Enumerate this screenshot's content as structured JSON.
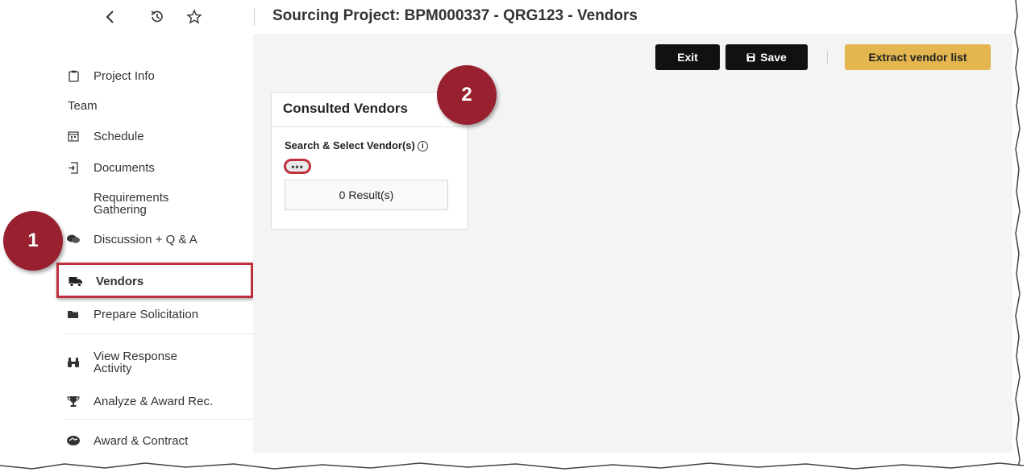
{
  "header": {
    "title": "Sourcing Project: BPM000337 - QRG123 - Vendors",
    "icons": [
      "back-icon",
      "history-icon",
      "star-icon"
    ]
  },
  "sidebar": {
    "items": [
      {
        "label": "Project Info",
        "icon": "clipboard-icon"
      },
      {
        "label": "Team"
      },
      {
        "label": "Schedule",
        "icon": "calendar-icon"
      },
      {
        "label": "Documents",
        "icon": "document-import-icon"
      },
      {
        "label": "Requirements Gathering"
      },
      {
        "label": "Discussion + Q & A",
        "icon": "comments-icon"
      },
      {
        "label": "Vendors",
        "icon": "truck-icon",
        "active": true
      },
      {
        "label": "Prepare Solicitation",
        "icon": "folder-icon"
      },
      {
        "label": "View Response Activity",
        "icon": "binoculars-icon"
      },
      {
        "label": "Analyze & Award Rec.",
        "icon": "trophy-icon"
      },
      {
        "label": "Award & Contract",
        "icon": "handshake-icon"
      }
    ]
  },
  "toolbar": {
    "exit_label": "Exit",
    "save_label": "Save",
    "extract_label": "Extract vendor list"
  },
  "card": {
    "title": "Consulted Vendors",
    "field_label": "Search & Select Vendor(s)",
    "more_label": "•••",
    "results": "0 Result(s)"
  },
  "callouts": {
    "one": "1",
    "two": "2"
  },
  "colors": {
    "highlight": "#c0303c",
    "callout": "#98202f",
    "accent_button": "#e3b64f",
    "dark_button": "#111111",
    "main_background": "#f4f4f4"
  }
}
